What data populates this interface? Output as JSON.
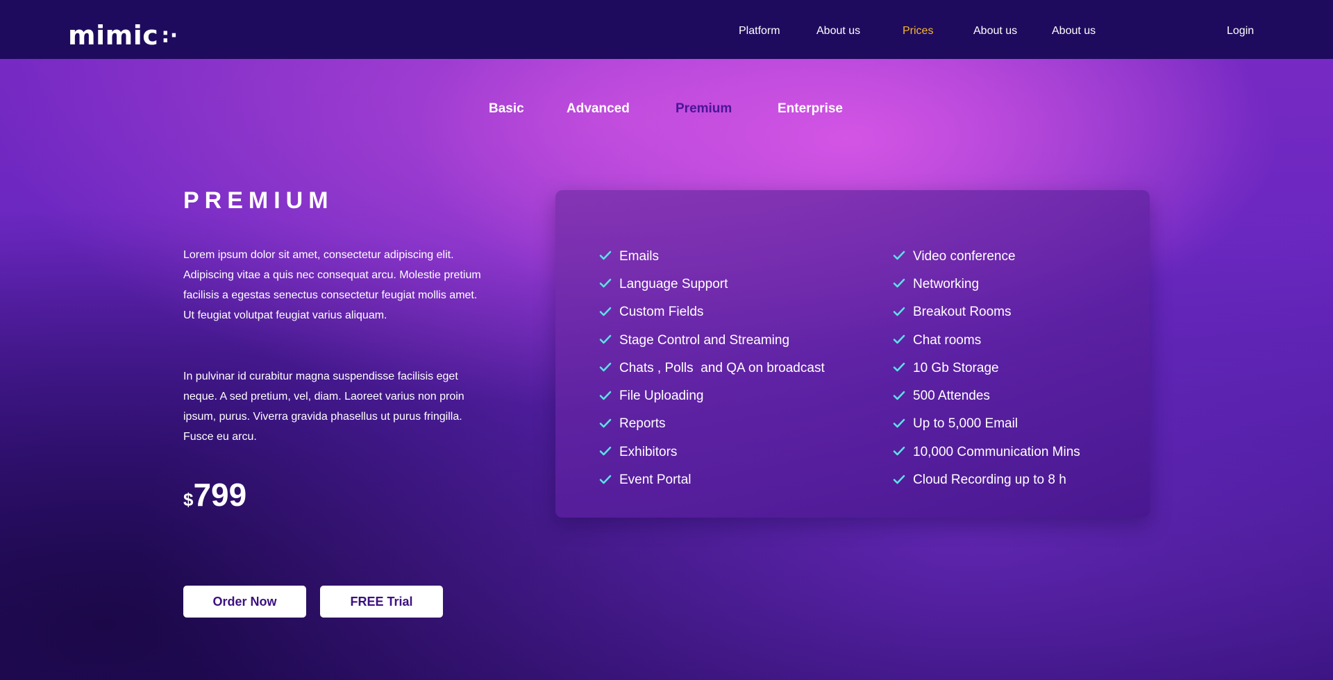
{
  "logo": {
    "text": "mimic",
    "mark": ":·"
  },
  "nav": {
    "items": [
      {
        "label": "Platform"
      },
      {
        "label": "About us"
      },
      {
        "label": "Prices",
        "active": true
      },
      {
        "label": "About us"
      },
      {
        "label": "About us"
      }
    ],
    "login": "Login"
  },
  "plans": {
    "tabs": [
      "Basic",
      "Advanced",
      "Premium",
      "Enterprise"
    ],
    "active": "Premium"
  },
  "plan": {
    "title": "PREMIUM",
    "paragraph1": "Lorem ipsum dolor sit amet, consectetur adipiscing elit. Adipiscing vitae a quis nec consequat arcu. Molestie pretium facilisis a egestas senectus consectetur feugiat mollis amet. Ut feugiat volutpat feugiat varius aliquam.",
    "paragraph2": "In pulvinar id curabitur magna suspendisse facilisis eget neque. A sed pretium, vel, diam. Laoreet varius non proin ipsum, purus. Viverra gravida phasellus ut purus fringilla. Fusce eu arcu.",
    "currency": "$",
    "price": "799",
    "order_label": "Order Now",
    "trial_label": "FREE Trial"
  },
  "features": {
    "left": [
      "Emails",
      "Language Support",
      "Custom Fields",
      "Stage Control and Streaming",
      "Chats , Polls  and QA on broadcast",
      "File Uploading",
      "Reports",
      "Exhibitors",
      "Event Portal"
    ],
    "right": [
      "Video conference",
      "Networking",
      "Breakout Rooms",
      "Chat rooms",
      "10 Gb Storage",
      "500 Attendes",
      "Up to 5,000 Email",
      "10,000 Communication Mins",
      "Cloud Recording up to 8 h"
    ]
  },
  "colors": {
    "header_bg": "#1f0b5e",
    "nav_active": "#f5b82e",
    "tab_active": "#4a1596",
    "check": "#5ee0e8",
    "button_text": "#3b0f80"
  }
}
